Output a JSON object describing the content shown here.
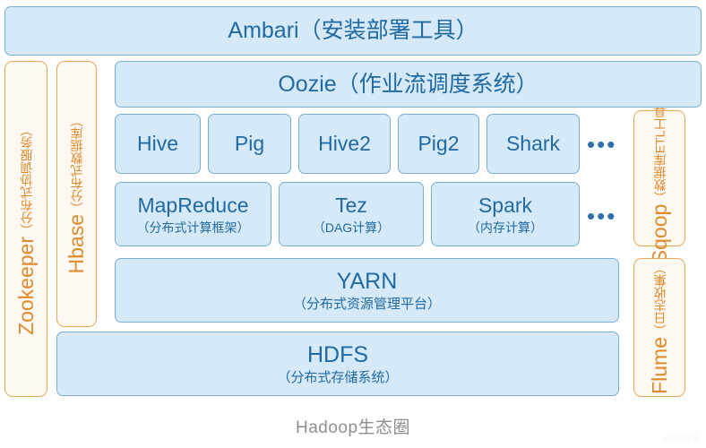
{
  "diagram": {
    "caption": "Hadoop生态圈",
    "watermark": "51CTO博客",
    "colors": {
      "box_fill": "#d6e9f8",
      "box_border": "#7aaed1",
      "box_text": "#1f6aa5",
      "side_fill": "#fdf8f1",
      "side_border": "#e9a857",
      "side_text": "#e08a2e",
      "caption_text": "#8f8f8f",
      "background": "#ffffff"
    },
    "ellipsis": "•••"
  },
  "top_banner": {
    "label": "Ambari（安装部署工具）"
  },
  "scheduler": {
    "label": "Oozie（作业流调度系统）"
  },
  "left_pillars": [
    {
      "name": "Zookeeper",
      "desc": "（分布式协调服务）"
    },
    {
      "name": "Hbase",
      "desc": "（分布式数据库）"
    }
  ],
  "right_pillars": [
    {
      "name": "Sqoop",
      "desc": "（数据库ETL工具）"
    },
    {
      "name": "Flume",
      "desc": "（日志收集）"
    }
  ],
  "query_tier": {
    "items": [
      {
        "name": "Hive"
      },
      {
        "name": "Pig"
      },
      {
        "name": "Hive2"
      },
      {
        "name": "Pig2"
      },
      {
        "name": "Shark"
      }
    ],
    "more": "•••"
  },
  "compute_tier": {
    "items": [
      {
        "name": "MapReduce",
        "desc": "（分布式计算框架）"
      },
      {
        "name": "Tez",
        "desc": "（DAG计算）"
      },
      {
        "name": "Spark",
        "desc": "（内存计算）"
      }
    ],
    "more": "•••"
  },
  "resource_tier": {
    "name": "YARN",
    "desc": "（分布式资源管理平台）"
  },
  "storage_tier": {
    "name": "HDFS",
    "desc": "（分布式存储系统）"
  }
}
